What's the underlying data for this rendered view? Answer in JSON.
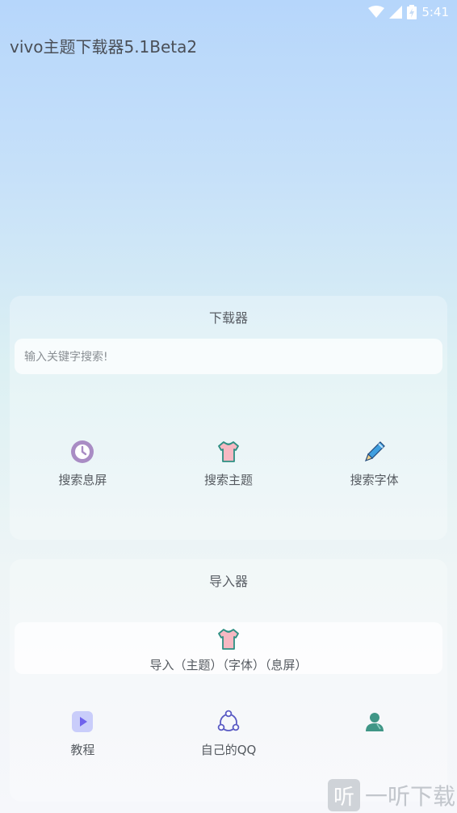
{
  "status_bar": {
    "time": "5:41"
  },
  "app": {
    "title": "vivo主题下载器5.1Beta2"
  },
  "downloader": {
    "title": "下载器",
    "search": {
      "value": "",
      "placeholder": "输入关键字搜索!"
    },
    "actions": [
      {
        "label": "搜索息屏",
        "icon": "clock-icon"
      },
      {
        "label": "搜索主题",
        "icon": "tshirt-icon"
      },
      {
        "label": "搜索字体",
        "icon": "pen-icon"
      }
    ]
  },
  "importer": {
    "title": "导入器",
    "import_label": "导入（主题）（字体）（息屏）",
    "import_icon": "tshirt-icon",
    "actions": [
      {
        "label": "教程",
        "icon": "play-icon"
      },
      {
        "label": "自己的QQ",
        "icon": "share-icon"
      },
      {
        "label": "",
        "icon": "user-icon"
      }
    ]
  },
  "watermark": {
    "badge": "听",
    "text": "一听下载"
  },
  "colors": {
    "clock": "#a98cc4",
    "tshirt": "#f7b8c2",
    "pen": "#3f9fe0",
    "play": "#8b7ff2",
    "share": "#5a5bc4",
    "user": "#3f9686"
  }
}
